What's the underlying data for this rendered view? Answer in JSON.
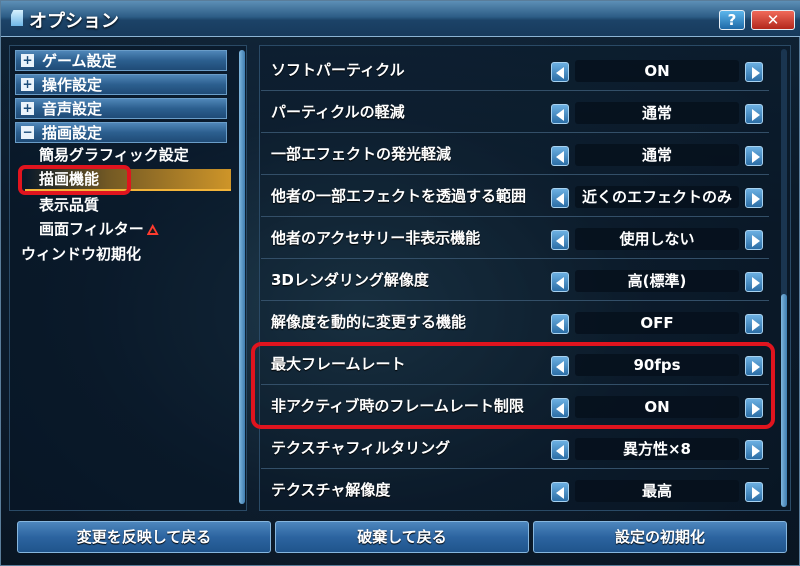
{
  "window": {
    "title": "オプション",
    "help_label": "?",
    "close_label": "✕"
  },
  "sidebar": {
    "categories": [
      {
        "toggle": "+",
        "label": "ゲーム設定"
      },
      {
        "toggle": "+",
        "label": "操作設定"
      },
      {
        "toggle": "+",
        "label": "音声設定"
      },
      {
        "toggle": "−",
        "label": "描画設定"
      }
    ],
    "subitems": [
      {
        "label": "簡易グラフィック設定"
      },
      {
        "label": "描画機能",
        "selected": true
      },
      {
        "label": "表示品質"
      },
      {
        "label": "画面フィルター",
        "warning_icon": "warning-triangle-icon"
      }
    ],
    "reset_window_label": "ウィンドウ初期化"
  },
  "settings": [
    {
      "label": "ソフトパーティクル",
      "value": "ON"
    },
    {
      "label": "パーティクルの軽減",
      "value": "通常"
    },
    {
      "label": "一部エフェクトの発光軽減",
      "value": "通常"
    },
    {
      "label": "他者の一部エフェクトを透過する範囲",
      "value": "近くのエフェクトのみ"
    },
    {
      "label": "他者のアクセサリー非表示機能",
      "value": "使用しない"
    },
    {
      "label": "3Dレンダリング解像度",
      "value": "高(標準)"
    },
    {
      "label": "解像度を動的に変更する機能",
      "value": "OFF"
    },
    {
      "label": "最大フレームレート",
      "value": "90fps"
    },
    {
      "label": "非アクティブ時のフレームレート制限",
      "value": "ON"
    },
    {
      "label": "テクスチャフィルタリング",
      "value": "異方性×8"
    },
    {
      "label": "テクスチャ解像度",
      "value": "最高"
    }
  ],
  "footer": {
    "apply_label": "変更を反映して戻る",
    "discard_label": "破棄して戻る",
    "reset_label": "設定の初期化"
  },
  "colors": {
    "highlight_red": "#e0141e",
    "selected_orange": "#f2b43a",
    "accent_blue": "#2c64a0"
  }
}
